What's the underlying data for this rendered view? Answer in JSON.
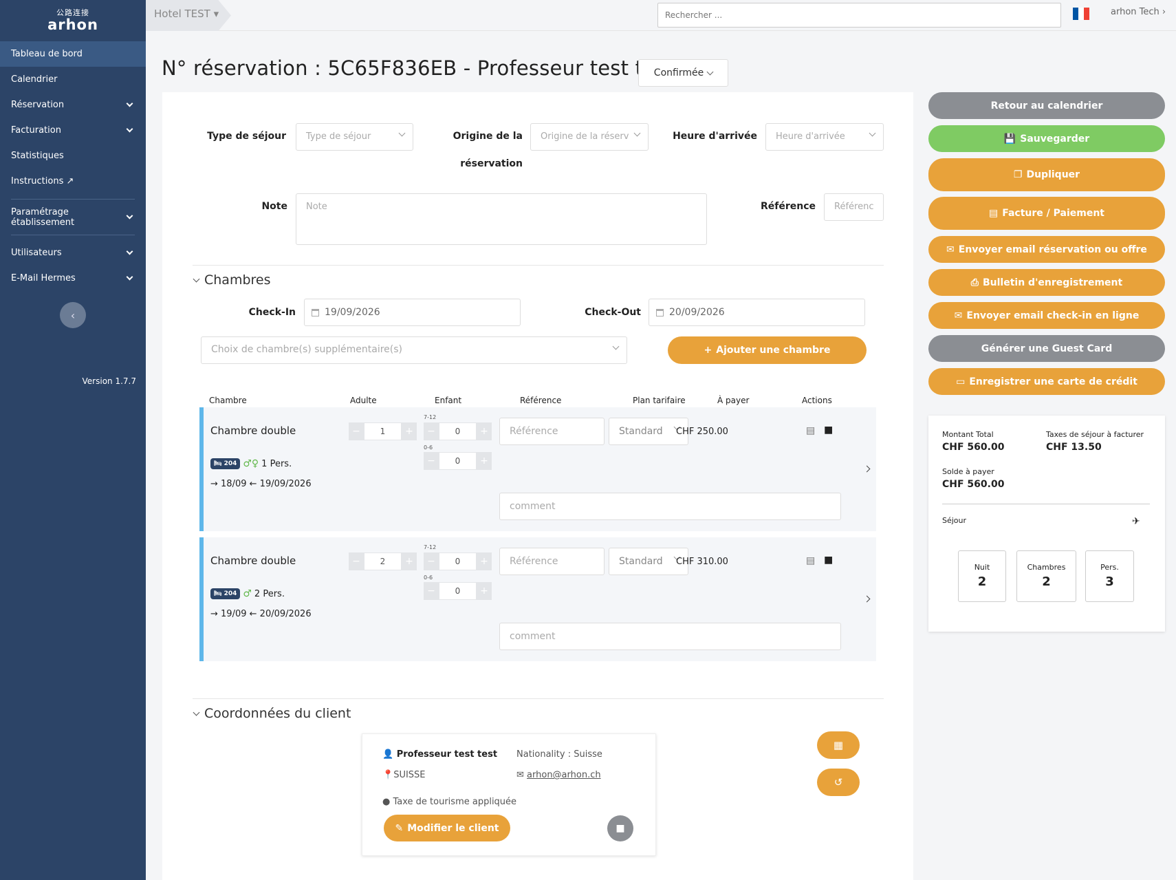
{
  "sidebar": {
    "logo_mark": "公路连接",
    "logo_text": "arhon",
    "items": [
      {
        "label": "Tableau de bord"
      },
      {
        "label": "Calendrier"
      },
      {
        "label": "Réservation"
      },
      {
        "label": "Facturation"
      },
      {
        "label": "Statistiques"
      },
      {
        "label": "Instructions"
      },
      {
        "label": "Paramétrage établissement"
      },
      {
        "label": "Utilisateurs"
      },
      {
        "label": "E-Mail Hermes"
      }
    ],
    "version": "Version 1.7.7"
  },
  "topbar": {
    "hotel": "Hotel TEST",
    "search_placeholder": "Rechercher ...",
    "user": "arhon Tech",
    "flag_colors": [
      "#0055a4",
      "#ffffff",
      "#ef4135"
    ]
  },
  "page": {
    "title": "N° réservation : 5C65F836EB - Professeur test test",
    "status": "Confirmée"
  },
  "form": {
    "type_sejour_label": "Type de séjour",
    "type_sejour_placeholder": "Type de séjour",
    "origine_label_1": "Origine de la",
    "origine_label_2": "réservation",
    "origine_placeholder": "Origine de la réserv",
    "heure_label": "Heure d'arrivée",
    "heure_placeholder": "Heure d'arrivée",
    "note_label": "Note",
    "note_placeholder": "Note",
    "reference_label": "Référence",
    "reference_placeholder": "Référenc"
  },
  "chambres": {
    "title": "Chambres",
    "checkin_label": "Check-In",
    "checkin_value": "19/09/2026",
    "checkout_label": "Check-Out",
    "checkout_value": "20/09/2026",
    "extra_placeholder": "Choix de chambre(s) supplémentaire(s)",
    "add_button": "Ajouter une chambre",
    "headers": [
      "Chambre",
      "Adulte",
      "Enfant",
      "Référence",
      "Plan tarifaire",
      "À payer",
      "Actions"
    ],
    "rows": [
      {
        "name": "Chambre double",
        "room_no": "204",
        "pers": "1 Pers.",
        "dates": "18/09",
        "dates2": "19/09/2026",
        "adults": "1",
        "age1": "7-12",
        "child1": "0",
        "age2": "0-6",
        "child2": "0",
        "ref_placeholder": "Référence",
        "plan": "Standard",
        "price": "CHF 250.00",
        "comment_placeholder": "comment"
      },
      {
        "name": "Chambre double",
        "room_no": "204",
        "pers": "2 Pers.",
        "dates": "19/09",
        "dates2": "20/09/2026",
        "adults": "2",
        "age1": "7-12",
        "child1": "0",
        "age2": "0-6",
        "child2": "0",
        "ref_placeholder": "Référence",
        "plan": "Standard",
        "price": "CHF 310.00",
        "comment_placeholder": "comment"
      }
    ]
  },
  "client": {
    "title": "Coordonnées du client",
    "name": "Professeur  test test",
    "nationality": "Nationality : Suisse",
    "country": "SUISSE",
    "email": "arhon@arhon.ch",
    "taxe": "Taxe de tourisme appliquée",
    "edit_button": "Modifier le client"
  },
  "actions": {
    "retour": "Retour au calendrier",
    "save": "Sauvegarder",
    "dup": "Dupliquer",
    "facture": "Facture / Paiement",
    "email_resa": "Envoyer email réservation ou offre",
    "bulletin": "Bulletin d'enregistrement",
    "email_checkin": "Envoyer email check-in en ligne",
    "guest_card": "Générer une Guest Card",
    "carte": "Enregistrer une carte de crédit"
  },
  "summary": {
    "total_label": "Montant Total",
    "total_value": "CHF 560.00",
    "taxes_label": "Taxes de séjour à facturer",
    "taxes_value": "CHF 13.50",
    "solde_label": "Solde à payer",
    "solde_value": "CHF 560.00",
    "sejour_label": "Séjour",
    "nuit_label": "Nuit",
    "nuit_value": "2",
    "chambres_label": "Chambres",
    "chambres_value": "2",
    "pers_label": "Pers.",
    "pers_value": "3"
  }
}
